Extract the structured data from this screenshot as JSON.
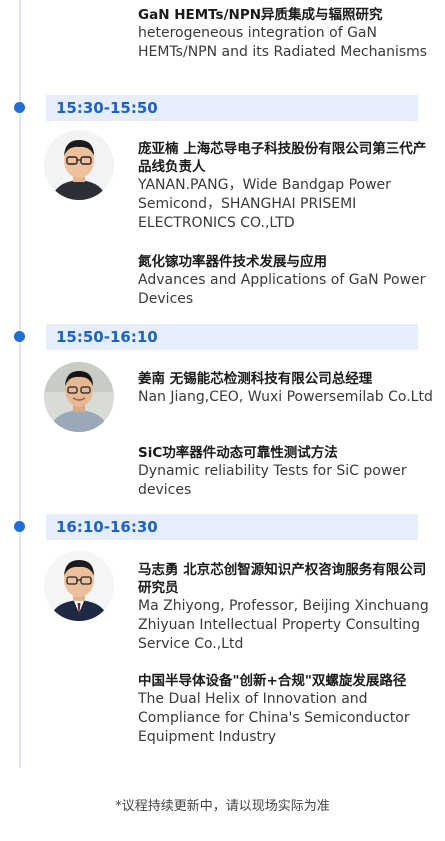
{
  "intro": {
    "topic_cn": "GaN HEMTs/NPN异质集成与辐照研究",
    "topic_en": "heterogeneous integration of GaN HEMTs/NPN and its Radiated Mechanisms"
  },
  "sessions": [
    {
      "time": "15:30-15:50",
      "speaker_cn": "庞亚楠 上海芯导电子科技股份有限公司第三代产品线负责人",
      "speaker_en": "YANAN.PANG，Wide Bandgap Power Semicond，SHANGHAI PRISEMI ELECTRONICS CO.,LTD",
      "topic_cn": "氮化镓功率器件技术发展与应用",
      "topic_en": "Advances and Applications of GaN Power Devices"
    },
    {
      "time": "15:50-16:10",
      "speaker_cn": "姜南 无锡能芯检测科技有限公司总经理",
      "speaker_en": "Nan Jiang,CEO, Wuxi Powersemilab Co.Ltd",
      "topic_cn": "SiC功率器件动态可靠性测试方法",
      "topic_en": "Dynamic reliability Tests for SiC power devices"
    },
    {
      "time": "16:10-16:30",
      "speaker_cn": "马志勇 北京芯创智源知识产权咨询服务有限公司研究员",
      "speaker_en": "Ma Zhiyong, Professor, Beijing Xinchuang Zhiyuan Intellectual Property Consulting Service Co.,Ltd",
      "topic_cn": "中国半导体设备\"创新+合规\"双螺旋发展路径",
      "topic_en": "The Dual Helix of Innovation and Compliance for China's Semiconductor Equipment Industry"
    }
  ],
  "footnote": "*议程持续更新中，请以现场实际为准",
  "colors": {
    "accent": "#1a62c9",
    "time_bar_bg": "#e6edfb",
    "dot": "#1f6fd6",
    "line": "#e3e6ee"
  }
}
